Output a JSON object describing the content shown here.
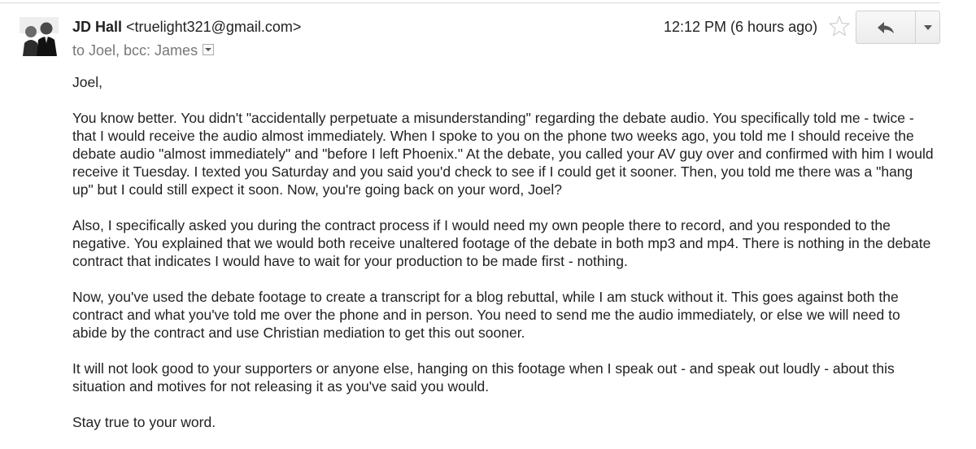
{
  "message": {
    "sender": {
      "name": "JD Hall",
      "email": "<truelight321@gmail.com>"
    },
    "recipients": "to Joel, bcc: James",
    "timestamp": "12:12 PM (6 hours ago)",
    "actions": {
      "star_icon": "star-outline-icon",
      "reply_icon": "reply-arrow-icon",
      "more_icon": "caret-down-icon"
    },
    "body": [
      "Joel,",
      "You know better. You didn't \"accidentally perpetuate a misunderstanding\" regarding the debate audio. You specifically told me - twice - that I would receive the audio almost immediately. When I spoke to you on the phone two weeks ago, you told me I should receive the debate audio \"almost immediately\" and \"before I left Phoenix.\" At the debate, you called your AV guy over and confirmed with him I would receive it Tuesday. I texted you Saturday and you said you'd check to see if I could get it sooner. Then, you told me there was a \"hang up\" but I could still expect it soon. Now, you're going back on your word, Joel?",
      "Also, I specifically asked you during the contract process if I would need my own people there to record, and you responded to the negative. You explained that we would both receive unaltered footage of the debate in both mp3 and mp4. There is nothing in the debate contract that indicates I would have to wait for your production to be made first - nothing.",
      "Now, you've used the debate footage to create a transcript for a blog rebuttal, while I am stuck without it. This goes against both the contract and what you've told me over the phone and in person. You need to send me the audio immediately, or else we will need to abide by the contract and use Christian mediation to get this out sooner.",
      "It will not look good to your supporters or anyone else, hanging on this footage when I speak out - and speak out loudly - about this situation and motives for not releasing it as you've said you would.",
      "Stay true to your word."
    ]
  }
}
